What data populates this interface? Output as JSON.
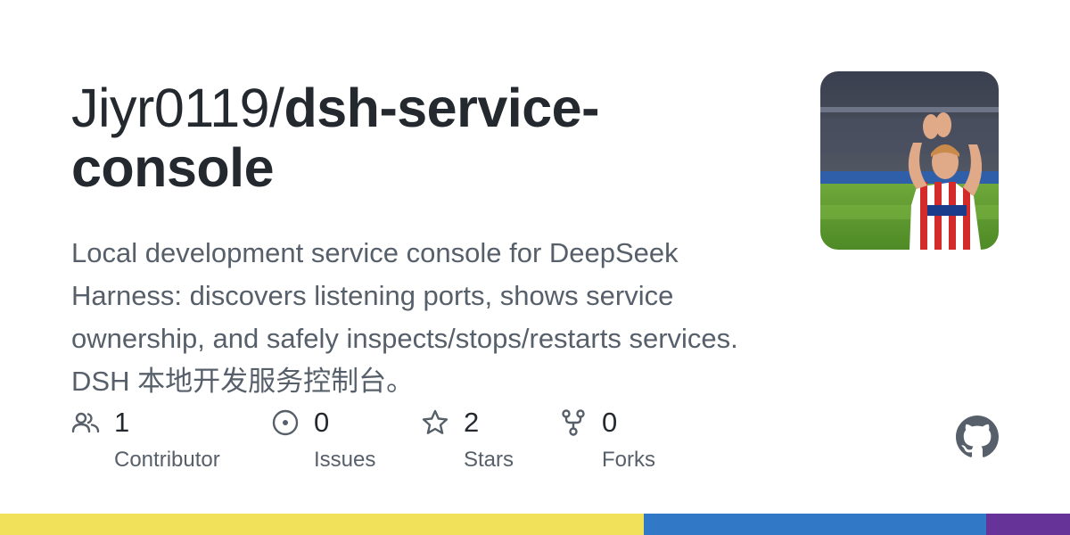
{
  "repo": {
    "owner": "Jiyr0119/",
    "name": "dsh-service-console",
    "description": "Local development service console for DeepSeek Harness: discovers listening ports, shows service ownership, and safely inspects/stops/restarts services. DSH 本地开发服务控制台。"
  },
  "stats": [
    {
      "icon": "people-icon",
      "count": "1",
      "label": "Contributor"
    },
    {
      "icon": "issue-opened-icon",
      "count": "0",
      "label": "Issues"
    },
    {
      "icon": "star-icon",
      "count": "2",
      "label": "Stars"
    },
    {
      "icon": "repo-forked-icon",
      "count": "0",
      "label": "Forks"
    }
  ],
  "language_bar": [
    {
      "color": "#f1e05a",
      "share": 0.602
    },
    {
      "color": "#3178c6",
      "share": 0.32
    },
    {
      "color": "#663399",
      "share": 0.078
    }
  ],
  "colors": {
    "text_primary": "#24292f",
    "text_secondary": "#57606a",
    "icon": "#57606a"
  }
}
